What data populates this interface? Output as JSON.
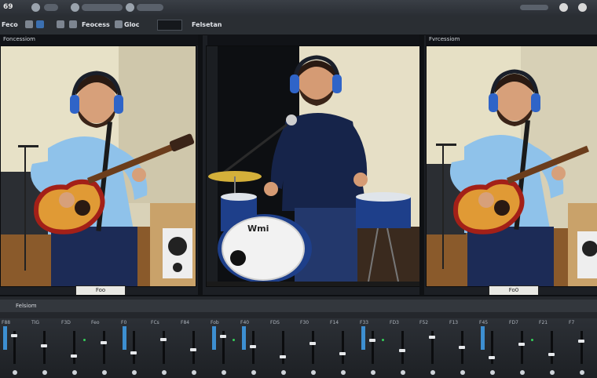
{
  "window": {
    "logo_text": "69",
    "toolbar_label_1": "Feco",
    "toolbar_label_2": "Feocess",
    "toolbar_label_3": "Gloc",
    "toolbar_label_4": "Felsetan"
  },
  "panes": {
    "left": {
      "header": "Foncessiom",
      "caption": "Foo"
    },
    "center": {
      "header": "",
      "caption": ""
    },
    "right": {
      "header": "Fvrcessiom",
      "caption": "Fo0"
    }
  },
  "drum_label": "Wmi",
  "timeline": {
    "ruler_text": "Felsiom"
  },
  "mixer": {
    "strips": [
      {
        "label": "F88"
      },
      {
        "label": "TIG"
      },
      {
        "label": "F3D"
      },
      {
        "label": "Feo"
      },
      {
        "label": "F0"
      },
      {
        "label": "FCs"
      },
      {
        "label": "F84"
      },
      {
        "label": "Fob"
      },
      {
        "label": "F40"
      },
      {
        "label": "FDS"
      },
      {
        "label": "F30"
      },
      {
        "label": "F14"
      },
      {
        "label": "F33"
      },
      {
        "label": "FD3"
      },
      {
        "label": "F52"
      },
      {
        "label": "F13"
      },
      {
        "label": "F45"
      },
      {
        "label": "FD7"
      },
      {
        "label": "F21"
      },
      {
        "label": "F7"
      }
    ]
  },
  "colors": {
    "accent_blue": "#3d8fd1",
    "meter_green": "#35d05a",
    "shirt_light": "#8fc2ea",
    "shirt_navy": "#1c2b56",
    "headphone_blue": "#2f64c8"
  }
}
